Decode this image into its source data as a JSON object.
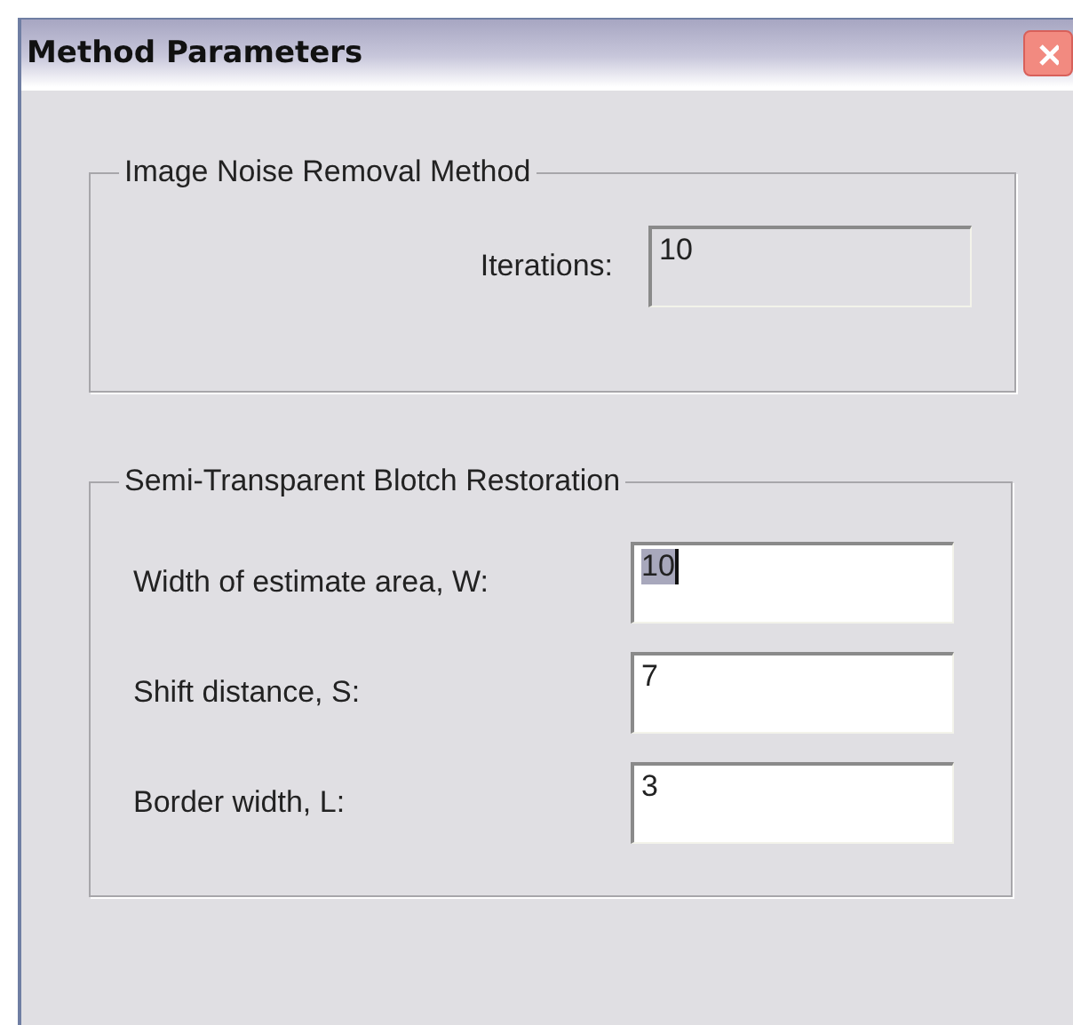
{
  "window": {
    "title": "Method Parameters"
  },
  "groups": [
    {
      "title": "Image Noise Removal Method",
      "kind": "aligned",
      "fields": [
        {
          "label": "Iterations:",
          "value": "10",
          "disabled": true,
          "selected": false
        }
      ]
    },
    {
      "title": "Semi-Transparent Blotch Restoration",
      "kind": "form",
      "fields": [
        {
          "label": "Width of estimate area, W:",
          "value": "10",
          "disabled": false,
          "selected": true
        },
        {
          "label": "Shift distance, S:",
          "value": "7",
          "disabled": false,
          "selected": false
        },
        {
          "label": "Border width, L:",
          "value": "3",
          "disabled": false,
          "selected": false
        }
      ]
    }
  ]
}
